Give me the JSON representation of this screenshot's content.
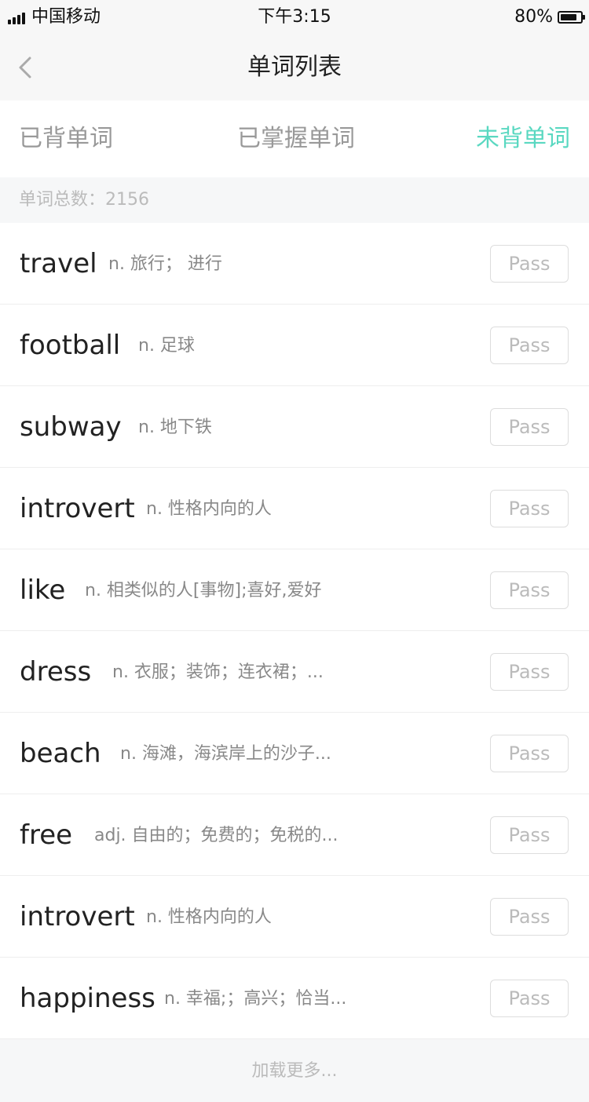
{
  "status_bar": {
    "carrier": "中国移动",
    "time": "下午3:15",
    "battery": "80%"
  },
  "nav": {
    "title": "单词列表"
  },
  "tabs": [
    {
      "label": "已背单词",
      "active": false
    },
    {
      "label": "已掌握单词",
      "active": false
    },
    {
      "label": "未背单词",
      "active": true
    }
  ],
  "summary": {
    "text": "单词总数：2156"
  },
  "words": [
    {
      "word": "travel",
      "definition": "n. 旅行；  进行",
      "button": "Pass"
    },
    {
      "word": "football",
      "definition": "n. 足球",
      "button": "Pass"
    },
    {
      "word": "subway",
      "definition": "n. 地下铁",
      "button": "Pass"
    },
    {
      "word": "introvert",
      "definition": "n.  性格内向的人",
      "button": "Pass"
    },
    {
      "word": "like",
      "definition": "n. 相类似的人[事物];喜好,爱好",
      "button": "Pass"
    },
    {
      "word": "dress",
      "definition": "n.  衣服；装饰；连衣裙；...",
      "button": "Pass"
    },
    {
      "word": "beach",
      "definition": "n.  海滩，海滨岸上的沙子...",
      "button": "Pass"
    },
    {
      "word": "free",
      "definition": "adj. 自由的；免费的；免税的...",
      "button": "Pass"
    },
    {
      "word": "introvert",
      "definition": "n.  性格内向的人",
      "button": "Pass"
    },
    {
      "word": "happiness",
      "definition": "n.  幸福;；高兴；恰当...",
      "button": "Pass"
    }
  ],
  "footer": {
    "load_more": "加载更多..."
  },
  "colors": {
    "accent": "#5ad8c1",
    "background": "#f6f7f8"
  }
}
